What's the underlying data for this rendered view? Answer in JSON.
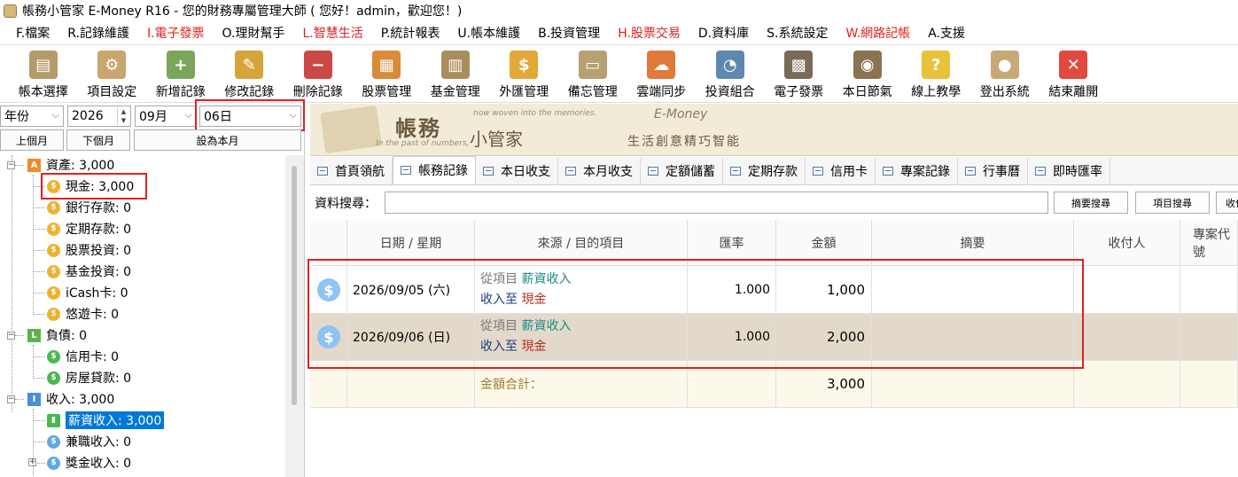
{
  "window": {
    "title": "帳務小管家 E-Money R16 - 您的財務專屬管理大師 ( 您好！admin，歡迎您！)"
  },
  "menu": [
    {
      "label": "F.檔案",
      "red": false
    },
    {
      "label": "R.記錄維護",
      "red": false
    },
    {
      "label": "I.電子發票",
      "red": true
    },
    {
      "label": "O.理財幫手",
      "red": false
    },
    {
      "label": "L.智慧生活",
      "red": true
    },
    {
      "label": "P.統計報表",
      "red": false
    },
    {
      "label": "U.帳本維護",
      "red": false
    },
    {
      "label": "B.投資管理",
      "red": false
    },
    {
      "label": "H.股票交易",
      "red": true
    },
    {
      "label": "D.資料庫",
      "red": false
    },
    {
      "label": "S.系統設定",
      "red": false
    },
    {
      "label": "W.網路記帳",
      "red": true
    },
    {
      "label": "A.支援",
      "red": false
    }
  ],
  "toolbar": [
    {
      "label": "帳本選擇",
      "icon": "ledger-icon",
      "color": "#b59a6a",
      "glyph": "▤"
    },
    {
      "label": "項目設定",
      "icon": "settings-icon",
      "color": "#c8a66e",
      "glyph": "⚙"
    },
    {
      "label": "新增記錄",
      "icon": "add-record-icon",
      "color": "#7aa65a",
      "glyph": "+"
    },
    {
      "label": "修改記錄",
      "icon": "edit-record-icon",
      "color": "#d6a53a",
      "glyph": "✎"
    },
    {
      "label": "刪除記錄",
      "icon": "delete-record-icon",
      "color": "#c94a44",
      "glyph": "−"
    },
    {
      "label": "股票管理",
      "icon": "stock-icon",
      "color": "#d98a3a",
      "glyph": "▦"
    },
    {
      "label": "基金管理",
      "icon": "fund-icon",
      "color": "#a88e5c",
      "glyph": "▥"
    },
    {
      "label": "外匯管理",
      "icon": "forex-icon",
      "color": "#e2a938",
      "glyph": "$"
    },
    {
      "label": "備忘管理",
      "icon": "memo-icon",
      "color": "#b8a070",
      "glyph": "▭"
    },
    {
      "label": "雲端同步",
      "icon": "cloud-sync-icon",
      "color": "#e07a3a",
      "glyph": "☁"
    },
    {
      "label": "投資組合",
      "icon": "portfolio-icon",
      "color": "#5f88b0",
      "glyph": "◔"
    },
    {
      "label": "電子發票",
      "icon": "qrcode-icon",
      "color": "#7a6a58",
      "glyph": "▩"
    },
    {
      "label": "本日節氣",
      "icon": "solar-term-icon",
      "color": "#8a7450",
      "glyph": "◉"
    },
    {
      "label": "線上教學",
      "icon": "help-icon",
      "color": "#e8c23a",
      "glyph": "?"
    },
    {
      "label": "登出系統",
      "icon": "logout-icon",
      "color": "#c9a878",
      "glyph": "●"
    },
    {
      "label": "結束離開",
      "icon": "exit-icon",
      "color": "#e04a3e",
      "glyph": "✕"
    }
  ],
  "filters": {
    "year_mode": "年份",
    "year": "2026",
    "month": "09月",
    "day": "06日",
    "prev_month": "上個月",
    "next_month": "下個月",
    "set_this_month": "設為本月"
  },
  "tree": {
    "assets": {
      "label": "資產: 3,000",
      "badge": "A",
      "color": "#f08a2a"
    },
    "asset_items": [
      {
        "label": "現金: 3,000"
      },
      {
        "label": "銀行存款: 0"
      },
      {
        "label": "定期存款: 0"
      },
      {
        "label": "股票投資: 0"
      },
      {
        "label": "基金投資: 0"
      },
      {
        "label": "iCash卡: 0"
      },
      {
        "label": "悠遊卡: 0"
      }
    ],
    "liabilities": {
      "label": "負債: 0",
      "badge": "L",
      "color": "#5fb04a"
    },
    "liability_items": [
      {
        "label": "信用卡: 0"
      },
      {
        "label": "房屋貸款: 0"
      }
    ],
    "income": {
      "label": "收入: 3,000",
      "badge": "I",
      "color": "#4a90d6"
    },
    "income_items": [
      {
        "label": "薪資收入: 3,000"
      },
      {
        "label": "兼職收入: 0"
      },
      {
        "label": "獎金收入: 0"
      }
    ]
  },
  "banner": {
    "title": "帳務",
    "subtitle": "小管家",
    "brand": "E-Money",
    "slogan": "生活創意精巧智能",
    "tag1": "now woven into the memories.",
    "tag2": "In the past of numbers,"
  },
  "tabs": [
    {
      "label": "首頁領航"
    },
    {
      "label": "帳務記錄"
    },
    {
      "label": "本日收支"
    },
    {
      "label": "本月收支"
    },
    {
      "label": "定額儲蓄"
    },
    {
      "label": "定期存款"
    },
    {
      "label": "信用卡"
    },
    {
      "label": "專案記錄"
    },
    {
      "label": "行事曆"
    },
    {
      "label": "即時匯率"
    }
  ],
  "search": {
    "label": "資料搜尋：",
    "value": "",
    "summary_btn": "摘要搜尋",
    "item_btn": "項目搜尋",
    "more_btn": "收付"
  },
  "table": {
    "headers": [
      "日期 / 星期",
      "來源 / 目的項目",
      "匯率",
      "金額",
      "摘要",
      "收付人",
      "專案代號"
    ],
    "rows": [
      {
        "date": "2026/09/05 (六)",
        "from_prefix": "從項目",
        "from": "薪資收入",
        "to_prefix": "收入至",
        "to": "現金",
        "rate": "1.000",
        "amount": "1,000",
        "memo": "",
        "payee": "",
        "project": ""
      },
      {
        "date": "2026/09/06 (日)",
        "from_prefix": "從項目",
        "from": "薪資收入",
        "to_prefix": "收入至",
        "to": "現金",
        "rate": "1.000",
        "amount": "2,000",
        "memo": "",
        "payee": "",
        "project": ""
      }
    ],
    "total_label": "金額合計：",
    "total": "3,000"
  }
}
